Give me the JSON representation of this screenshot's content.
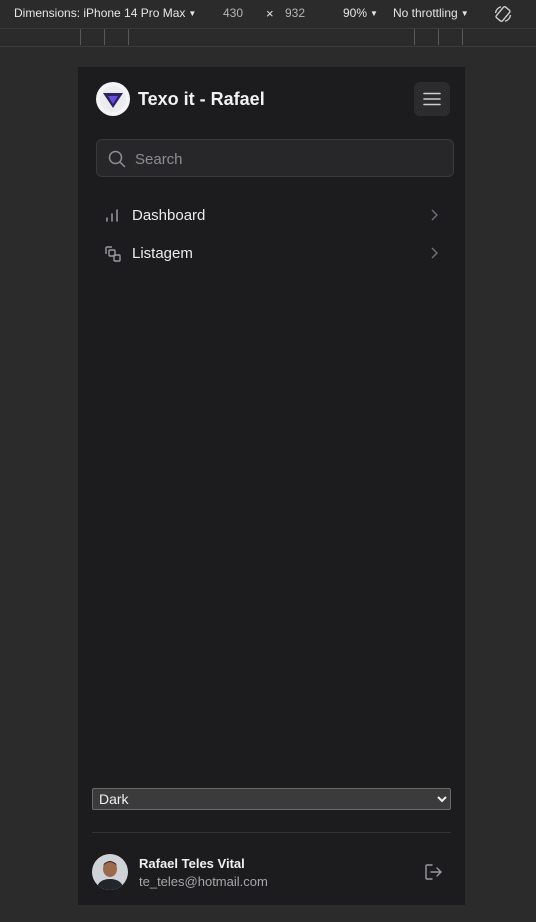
{
  "devtools": {
    "dimensions_label": "Dimensions: iPhone 14 Pro Max",
    "width": "430",
    "times": "×",
    "height": "932",
    "zoom": "90%",
    "throttling": "No throttling",
    "rotate_icon": "rotate-icon"
  },
  "app": {
    "title": "Texo it - Rafael",
    "logo_icon": "triangle-logo-icon",
    "menu_icon": "hamburger-icon",
    "search": {
      "placeholder": "Search"
    },
    "nav": [
      {
        "label": "Dashboard",
        "icon": "bar-chart-icon"
      },
      {
        "label": "Listagem",
        "icon": "copy-icon"
      }
    ],
    "theme": {
      "selected": "Dark"
    },
    "user": {
      "name": "Rafael Teles Vital",
      "email": "te_teles@hotmail.com"
    },
    "colors": {
      "accent": "#5b3fd6",
      "background": "#1c1c1e"
    }
  }
}
